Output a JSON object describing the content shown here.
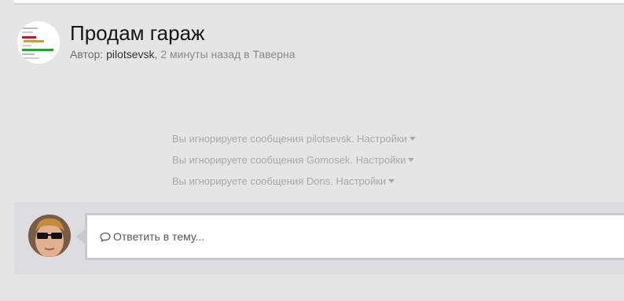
{
  "topic": {
    "title": "Продам гараж",
    "meta": {
      "author_prefix": "Автор: ",
      "author": "pilotsevsk",
      "separator": ", ",
      "time": "2 минуты назад",
      "in_label": " в ",
      "forum": "Таверна"
    }
  },
  "ignored": {
    "prefix": "Вы игнорируете сообщения",
    "settings_label": "Настройки",
    "rows": [
      {
        "user": "pilotsevsk"
      },
      {
        "user": "Gomosek"
      },
      {
        "user": "Dons"
      }
    ]
  },
  "reply": {
    "placeholder": "Ответить в тему..."
  },
  "icons": {
    "author_avatar": "author-avatar-image",
    "user_avatar": "user-avatar-image",
    "settings_caret": "caret-down-icon",
    "reply_icon": "comment-bubble-icon"
  },
  "colors": {
    "background": "#e5e5e5",
    "title": "#151515",
    "muted": "#a8a8a8",
    "reply_border": "#c9c9cc"
  }
}
